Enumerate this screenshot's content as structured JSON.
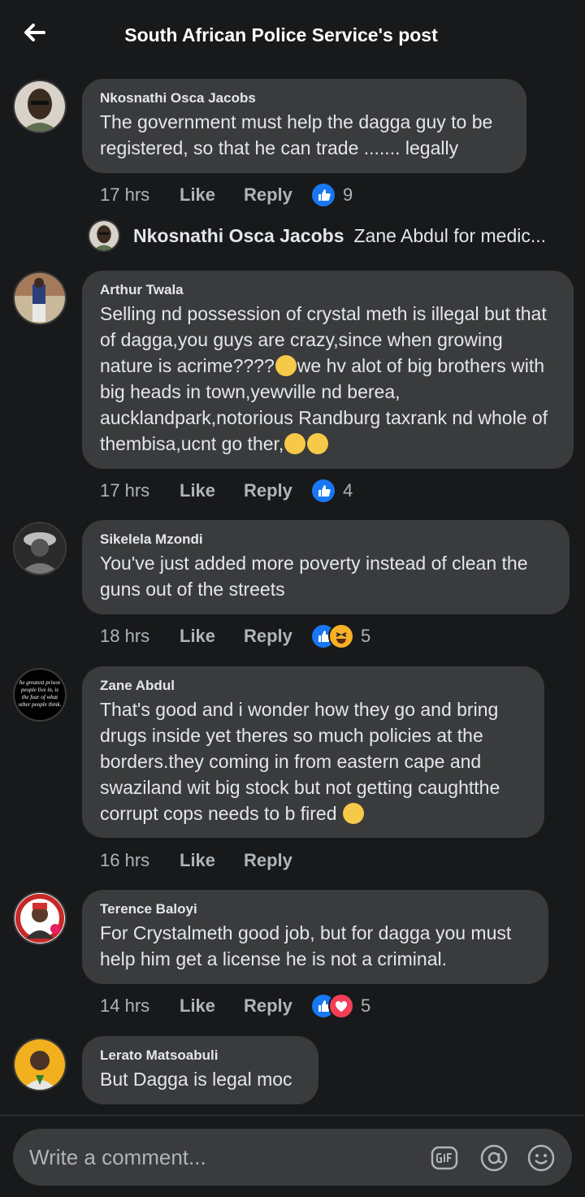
{
  "header": {
    "title": "South African Police Service's post"
  },
  "comments": [
    {
      "name": "Nkosnathi Osca Jacobs",
      "text": "The government must help the dagga guy to be registered, so that he can trade ....... legally",
      "time": "17 hrs",
      "like": "Like",
      "reply": "Reply",
      "reactions": [
        "like"
      ],
      "count": "9"
    },
    {
      "name": "Arthur Twala",
      "text_parts": [
        "Selling nd possession of crystal meth is illegal but that of dagga,you guys are crazy,since when growing nature is acrime????",
        "we hv alot of big brothers with big heads in  town,yewville nd berea, aucklandpark,notorious Randburg taxrank nd whole of thembisa,ucnt go ther,"
      ],
      "time": "17 hrs",
      "like": "Like",
      "reply": "Reply",
      "reactions": [
        "like"
      ],
      "count": "4"
    },
    {
      "name": "Sikelela Mzondi",
      "text": "You've just added more poverty instead of clean the guns out of the streets",
      "time": "18 hrs",
      "like": "Like",
      "reply": "Reply",
      "reactions": [
        "like",
        "haha"
      ],
      "count": "5"
    },
    {
      "name": "Zane Abdul",
      "text": "That's good and i wonder how they go and bring drugs inside yet theres so much policies at the borders.they coming in from eastern cape and swaziland wit big stock but not getting caughtthe corrupt cops needs to b fired",
      "time": "16 hrs",
      "like": "Like",
      "reply": "Reply",
      "avatar_text": "he greatest prison people live in, is the fear of what other people think."
    },
    {
      "name": "Terence Baloyi",
      "text": "For Crystalmeth good job, but for dagga you must help him get a license he is not a criminal.",
      "time": "14 hrs",
      "like": "Like",
      "reply": "Reply",
      "reactions": [
        "like",
        "love"
      ],
      "count": "5"
    },
    {
      "name": "Lerato Matsoabuli",
      "text": "But Dagga is legal moc"
    }
  ],
  "reply_preview": {
    "name": "Nkosnathi Osca Jacobs",
    "text": "Zane Abdul for medic..."
  },
  "composer": {
    "placeholder": "Write a comment..."
  },
  "colors": {
    "background": "#18191a",
    "bubble": "#3a3b3c",
    "like_blue": "#1877f2",
    "haha_yellow": "#f7b125",
    "love_red": "#f33e58"
  }
}
